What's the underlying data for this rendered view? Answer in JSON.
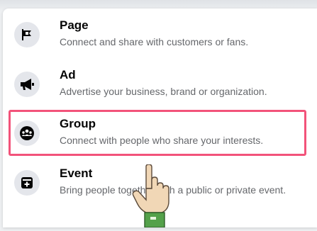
{
  "menu": {
    "items": [
      {
        "title": "Page",
        "description": "Connect and share with customers or fans.",
        "icon": "flag-icon"
      },
      {
        "title": "Ad",
        "description": "Advertise your business, brand or organization.",
        "icon": "megaphone-icon"
      },
      {
        "title": "Group",
        "description": "Connect with people who share your interests.",
        "icon": "group-icon"
      },
      {
        "title": "Event",
        "description": "Bring people together with a public or private event.",
        "icon": "event-icon"
      }
    ]
  },
  "colors": {
    "highlight": "#f2537a",
    "icon_bg": "#e4e6eb",
    "title": "#050505",
    "description": "#65676b"
  }
}
